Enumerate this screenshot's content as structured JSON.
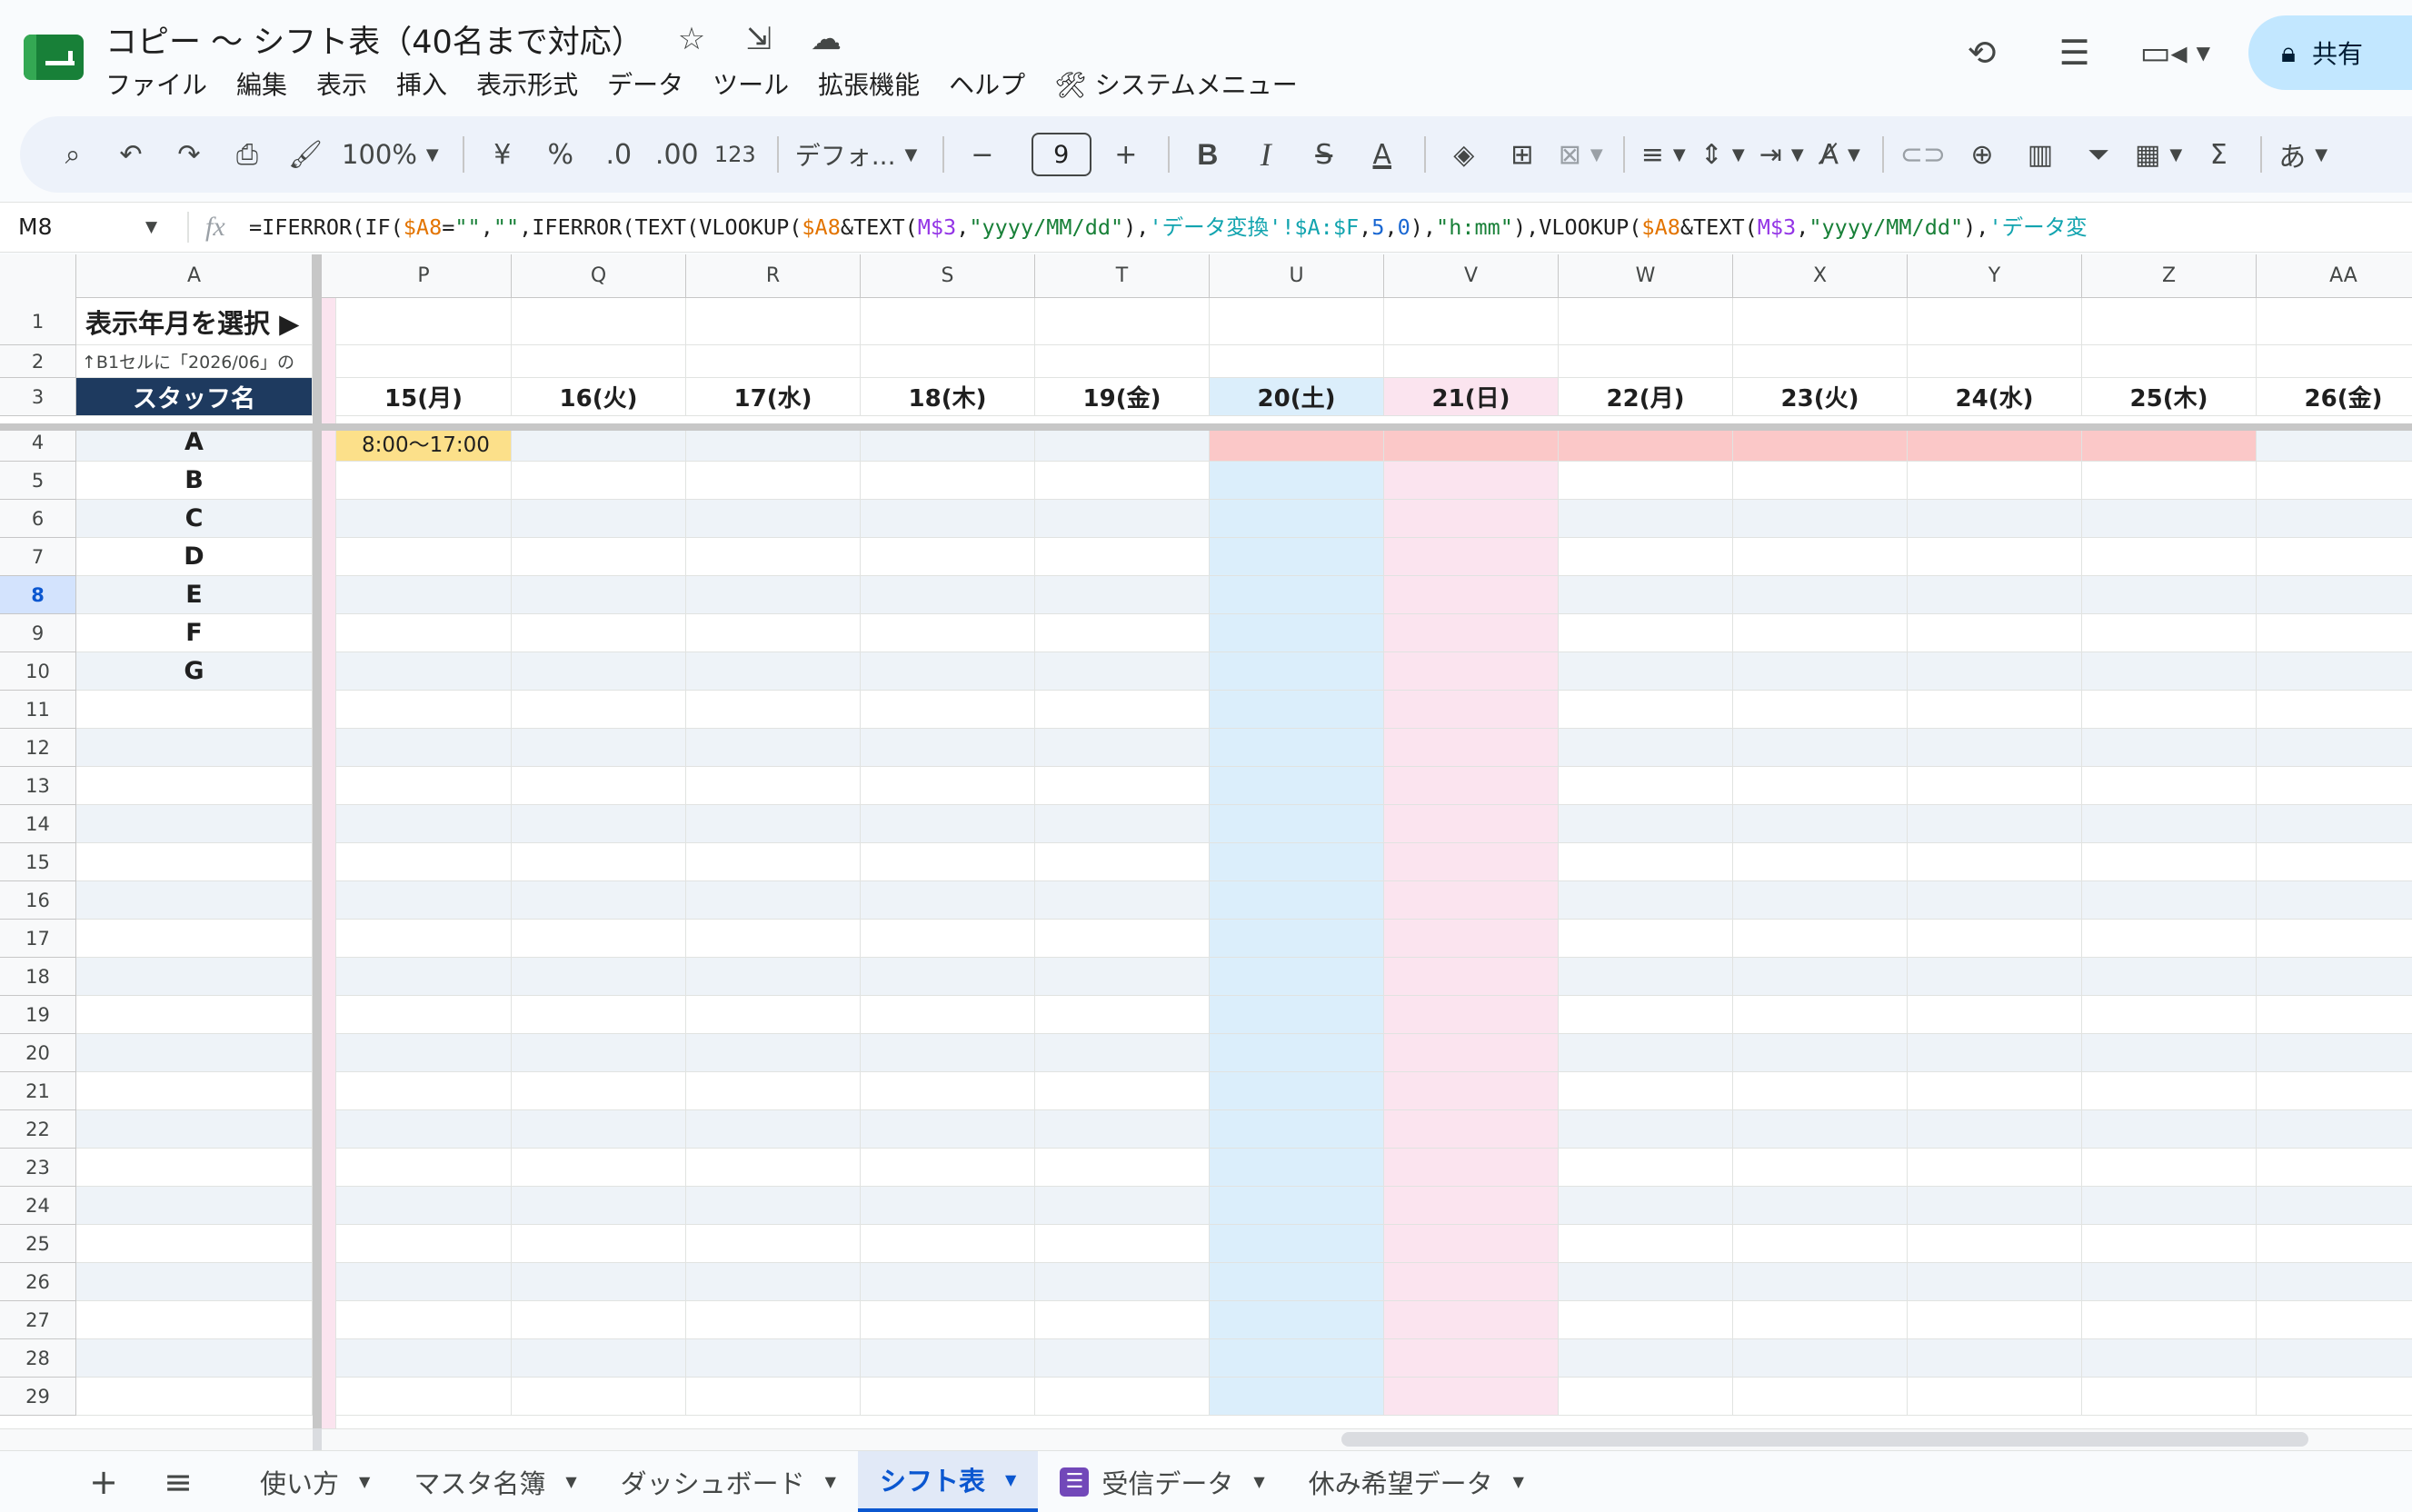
{
  "header": {
    "title": "コピー 〜 シフト表（40名まで対応）",
    "title_icons": [
      "star-icon",
      "move-folder-icon",
      "cloud-saved-icon"
    ],
    "menu": [
      "ファイル",
      "編集",
      "表示",
      "挿入",
      "表示形式",
      "データ",
      "ツール",
      "拡張機能",
      "ヘルプ",
      "🛠 システムメニュー"
    ],
    "share_label": "共有"
  },
  "toolbar": {
    "zoom": "100%",
    "currency": "¥",
    "percent": "%",
    "dec_decrease": ".0",
    "dec_increase": ".00",
    "number_format": "123",
    "font": "デフォ...",
    "font_size": "9",
    "bold": "B",
    "italic": "I",
    "strike": "S",
    "text_color": "A",
    "input_mode": "あ"
  },
  "formula_bar": {
    "cell_ref": "M8",
    "fx": "fx",
    "parts": [
      "=IFERROR(IF(",
      "$A8",
      "=",
      "\"\"",
      ",",
      "\"\"",
      ",IFERROR(TEXT(VLOOKUP(",
      "$A8",
      "&TEXT(",
      "M$3",
      ",",
      "\"yyyy/MM/dd\"",
      "),",
      "'データ変換'!$A:$F",
      ",",
      "5",
      ",",
      "0",
      "),",
      "\"h:mm\"",
      "),VLOOKUP(",
      "$A8",
      "&TEXT(",
      "M$3",
      ",",
      "\"yyyy/MM/dd\"",
      "),",
      "'データ変"
    ]
  },
  "grid": {
    "columns": [
      "A",
      "P",
      "Q",
      "R",
      "S",
      "T",
      "U",
      "V",
      "W",
      "X",
      "Y",
      "Z",
      "AA"
    ],
    "rows": [
      "1",
      "2",
      "3",
      "4",
      "5",
      "6",
      "7",
      "8",
      "9",
      "10",
      "11",
      "12",
      "13",
      "14",
      "15",
      "16",
      "17",
      "18",
      "19",
      "20",
      "21",
      "22",
      "23",
      "24",
      "25",
      "26",
      "27",
      "28",
      "29"
    ],
    "active_row": "8",
    "a1": "表示年月を選択 ▶",
    "a2": "↑B1セルに「2026/06」の",
    "a3": "スタッフ名",
    "staff": [
      "A",
      "B",
      "C",
      "D",
      "E",
      "F",
      "G"
    ],
    "dates": [
      "15(月)",
      "16(火)",
      "17(水)",
      "18(木)",
      "19(金)",
      "20(土)",
      "21(日)",
      "22(月)",
      "23(火)",
      "24(水)",
      "25(木)",
      "26(金)"
    ],
    "shift_p4": "8:00〜17:00"
  },
  "tabs": {
    "add": "+",
    "list": "≡",
    "sheets": [
      "使い方",
      "マスタ名簿",
      "ダッシュボード",
      "シフト表",
      "受信データ",
      "休み希望データ"
    ],
    "active": "シフト表"
  },
  "colors": {
    "staff_header": "#1e3a5f",
    "saturday": "#dbeefb",
    "sunday": "#fbe4ef",
    "holiday_row": "#fbc8c8",
    "shift_cell": "#fce08a",
    "active_tab": "#0b57d0"
  }
}
